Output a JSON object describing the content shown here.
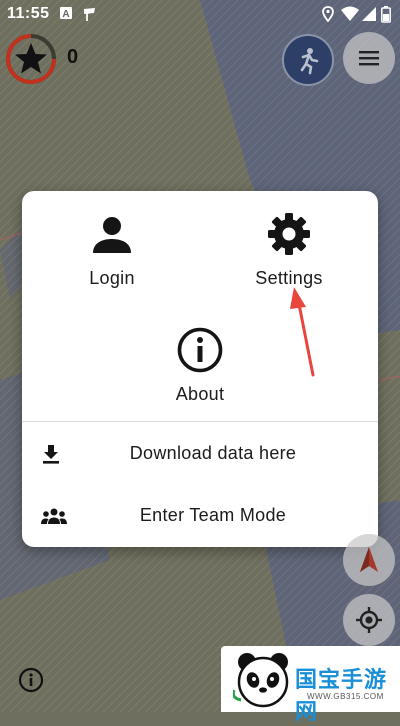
{
  "status_bar": {
    "time": "11:55",
    "icons": [
      "notification-a-icon",
      "notification-flag-icon",
      "location-icon",
      "wifi-icon",
      "signal-icon",
      "battery-icon"
    ]
  },
  "score": {
    "value": "0",
    "icon": "star-icon",
    "ring_color": "#c0321e"
  },
  "map": {
    "icons": [
      "runner-mode-icon",
      "menu-icon",
      "compass-icon",
      "locate-icon",
      "info-icon"
    ]
  },
  "menu": {
    "tiles": [
      {
        "label": "Login",
        "icon": "person-icon"
      },
      {
        "label": "Settings",
        "icon": "gear-icon"
      },
      {
        "label": "About",
        "icon": "info-circle-icon"
      }
    ],
    "rows": [
      {
        "label": "Download data here",
        "icon": "download-icon"
      },
      {
        "label": "Enter Team Mode",
        "icon": "group-icon"
      }
    ]
  },
  "annotation": {
    "color": "#e8453c"
  },
  "watermark": {
    "brand": "国宝手游网",
    "url": "WWW.GB315.COM"
  }
}
